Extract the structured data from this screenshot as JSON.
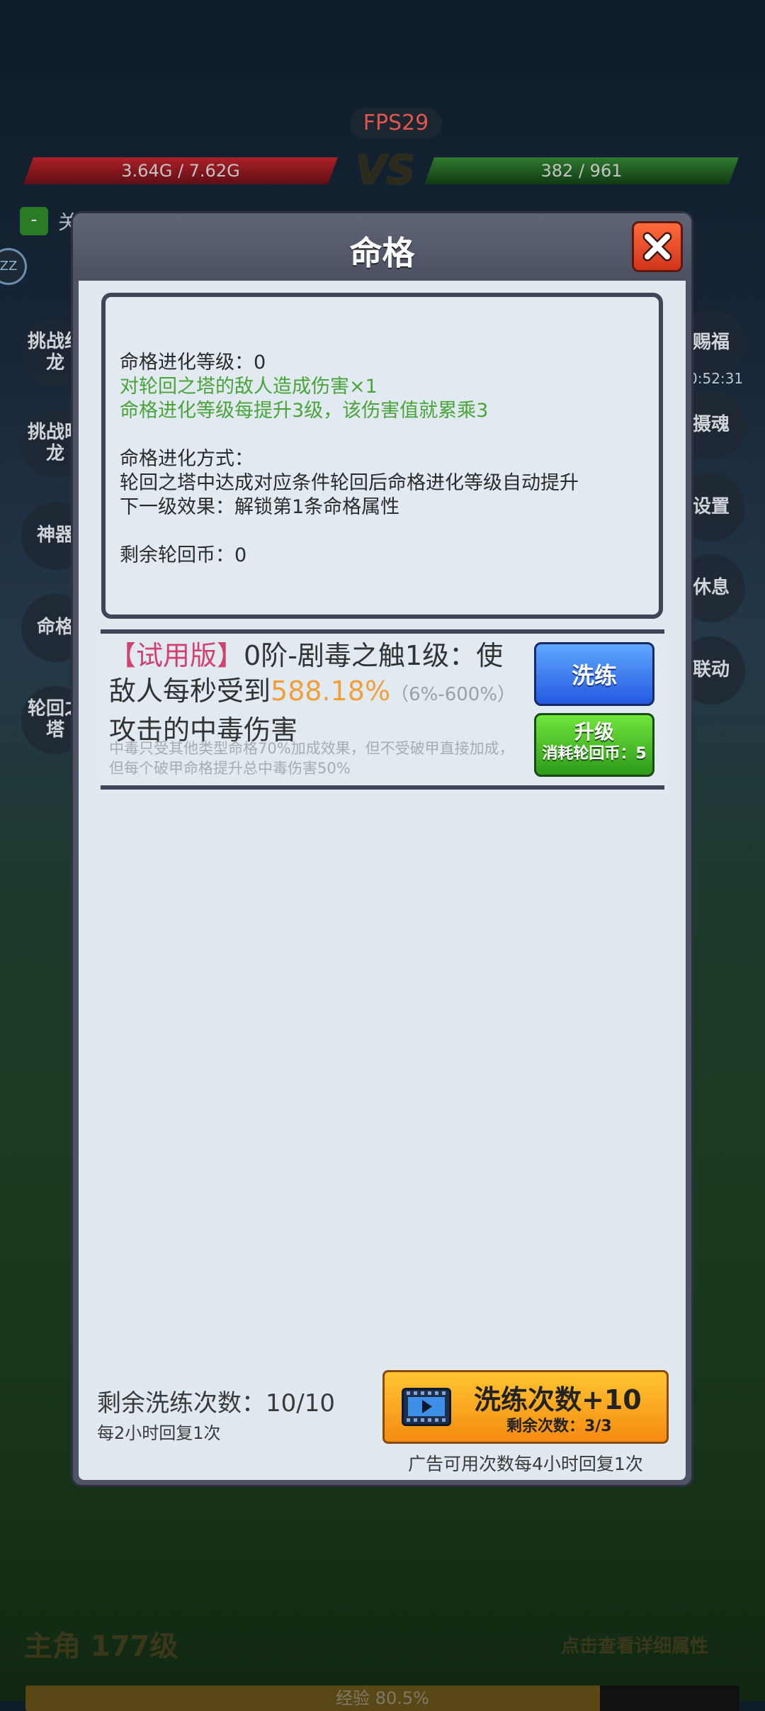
{
  "hud": {
    "fps": "FPS29",
    "player_hp": "3.64G / 7.62G",
    "vs": "VS",
    "enemy_hp": "382 / 961",
    "toggle_symbol": "-",
    "toggle_label": "关",
    "zz": "ZZ",
    "left_buttons": [
      "挑战红龙",
      "挑战暗龙",
      "神器",
      "命格",
      "轮回之塔"
    ],
    "right_buttons": [
      "赐福",
      "摄魂",
      "设置",
      "休息",
      "联动"
    ],
    "timer": "0:52:31",
    "hero_level": "主角 177级",
    "detail_link": "点击查看详细属性",
    "exp_text": "经验 80.5%",
    "exp_progress": 0.805
  },
  "modal": {
    "title": "命格",
    "info": {
      "evolution_level": "命格进化等级：0",
      "damage_bonus": "对轮回之塔的敌人造成伤害×1",
      "multiply_rule": "命格进化等级每提升3级，该伤害值就累乘3",
      "method_title": "命格进化方式：",
      "method_desc": "轮回之塔中达成对应条件轮回后命格进化等级自动提升",
      "next_effect": "下一级效果：解锁第1条命格属性",
      "remaining_coins": "剩余轮回币：0"
    },
    "attribute": {
      "trial_tag": "【试用版】",
      "name": "0阶-剧毒之触1级：使敌人每秒受到",
      "percent": "588.18%",
      "range": "（6%-600%）",
      "suffix": "攻击的中毒伤害",
      "note": "中毒只受其他类型命格70%加成效果，但不受破甲直接加成，但每个破甲命格提升总中毒伤害50%",
      "refine_label": "洗练",
      "upgrade_label": "升级",
      "upgrade_cost": "消耗轮回币：5"
    },
    "footer": {
      "remaining_refines": "剩余洗练次数：10/10",
      "recovery": "每2小时回复1次",
      "ad_button_main": "洗练次数+10",
      "ad_button_sub": "剩余次数：3/3",
      "ad_note": "广告可用次数每4小时回复1次"
    }
  }
}
